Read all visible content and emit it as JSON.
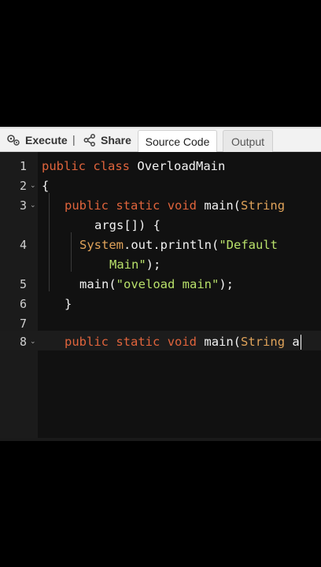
{
  "toolbar": {
    "execute_label": "Execute",
    "separator": "|",
    "share_label": "Share",
    "tabs": [
      {
        "label": "Source Code"
      },
      {
        "label": "Output"
      }
    ]
  },
  "editor": {
    "lines": [
      {
        "num": "1"
      },
      {
        "num": "2"
      },
      {
        "num": "3"
      },
      {
        "num": "4"
      },
      {
        "num": "5"
      },
      {
        "num": "6"
      },
      {
        "num": "7"
      },
      {
        "num": "8"
      }
    ],
    "tokens": {
      "public": "public",
      "class": "class",
      "class_name": "OverloadMain",
      "open_brace": "{",
      "static": "static",
      "void": "void",
      "main": "main(",
      "string_type": "String",
      "args": "args[]) {",
      "system": "System",
      "out_println": ".out.println(",
      "str_default_1": "\"Default",
      "str_default_2": "Main\"",
      "close_call": ");",
      "main_call": "main(",
      "str_overload": "\"oveload main\"",
      "close_brace": "}",
      "partial_arg": "a"
    }
  },
  "colors": {
    "keyword": "#e0643c",
    "type": "#e0a35a",
    "string": "#b8e06a",
    "text": "#f2f2f2",
    "background": "#111111"
  }
}
